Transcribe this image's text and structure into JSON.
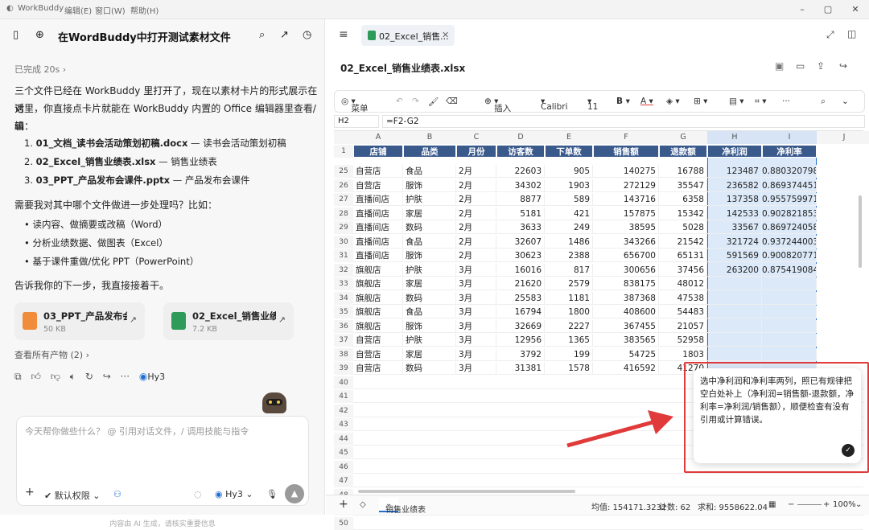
{
  "titlebar": {
    "app": "WorkBuddy",
    "menus": [
      "编辑(E)",
      "窗口(W)",
      "帮助(H)"
    ]
  },
  "chat": {
    "title": "在WordBuddy中打开测试素材文件",
    "done": "已完成 20s",
    "intro1": "三个文件已经在 WorkBuddy 里打开了，现在以素材卡片的形式展示在对",
    "intro2": "话里，你直接点卡片就能在 WorkBuddy 内置的 Office 编辑器里查看/编",
    "intro3": "辑：",
    "files": [
      {
        "num": "1.",
        "name": "01_文档_读书会活动策划初稿.docx",
        "desc": " — 读书会活动策划初稿"
      },
      {
        "num": "2.",
        "name": "02_Excel_销售业绩表.xlsx",
        "desc": " — 销售业绩表"
      },
      {
        "num": "3.",
        "name": "03_PPT_产品发布会课件.pptx",
        "desc": " — 产品发布会课件"
      }
    ],
    "question": "需要我对其中哪个文件做进一步处理吗？比如：",
    "bullets": [
      "读内容、做摘要或改稿（Word）",
      "分析业绩数据、做图表（Excel）",
      "基于课件重做/优化 PPT（PowerPoint）"
    ],
    "closing": "告诉我你的下一步，我直接接着干。",
    "cards": [
      {
        "name": "03_PPT_产品发布会...",
        "size": "50 KB",
        "color": "#f08c3a"
      },
      {
        "name": "02_Excel_销售业绩...",
        "size": "7.2 KB",
        "color": "#2e9b5a"
      }
    ],
    "view_all": "查看所有产物 (2)",
    "model": "Hy3"
  },
  "input": {
    "placeholder": "今天帮你做些什么？ @ 引用对话文件，/ 调用技能与指令",
    "permission": "默认权限",
    "model": "Hy3"
  },
  "footer": "内容由 AI 生成，请核实重要信息",
  "editor": {
    "tab_label": "02_Excel_销售...",
    "file_name": "02_Excel_销售业绩表.xlsx",
    "toolbar": {
      "menu": "菜单",
      "insert": "插入",
      "font": "Calibri",
      "size": "11"
    },
    "cell_ref": "H2",
    "formula": "=F2-G2",
    "columns": [
      "A",
      "B",
      "C",
      "D",
      "E",
      "F",
      "G",
      "H",
      "I",
      "J"
    ],
    "headers": [
      "店铺",
      "品类",
      "月份",
      "访客数",
      "下单数",
      "销售额",
      "退款额",
      "净利润",
      "净利率"
    ],
    "rows": [
      [
        "25",
        "自营店",
        "食品",
        "2月",
        "22603",
        "905",
        "140275",
        "16788",
        "123487",
        "0.880320798"
      ],
      [
        "26",
        "自营店",
        "服饰",
        "2月",
        "34302",
        "1903",
        "272129",
        "35547",
        "236582",
        "0.869374451"
      ],
      [
        "27",
        "直播间店",
        "护肤",
        "2月",
        "8877",
        "589",
        "143716",
        "6358",
        "137358",
        "0.955759971"
      ],
      [
        "28",
        "直播间店",
        "家居",
        "2月",
        "5181",
        "421",
        "157875",
        "15342",
        "142533",
        "0.902821853"
      ],
      [
        "29",
        "直播间店",
        "数码",
        "2月",
        "3633",
        "249",
        "38595",
        "5028",
        "33567",
        "0.869724058"
      ],
      [
        "30",
        "直播间店",
        "食品",
        "2月",
        "32607",
        "1486",
        "343266",
        "21542",
        "321724",
        "0.937244003"
      ],
      [
        "31",
        "直播间店",
        "服饰",
        "2月",
        "30623",
        "2388",
        "656700",
        "65131",
        "591569",
        "0.900820771"
      ],
      [
        "32",
        "旗舰店",
        "护肤",
        "3月",
        "16016",
        "817",
        "300656",
        "37456",
        "263200",
        "0.875419084"
      ],
      [
        "33",
        "旗舰店",
        "家居",
        "3月",
        "21620",
        "2579",
        "838175",
        "48012",
        "",
        ""
      ],
      [
        "34",
        "旗舰店",
        "数码",
        "3月",
        "25583",
        "1181",
        "387368",
        "47538",
        "",
        ""
      ],
      [
        "35",
        "旗舰店",
        "食品",
        "3月",
        "16794",
        "1800",
        "408600",
        "54483",
        "",
        ""
      ],
      [
        "36",
        "旗舰店",
        "服饰",
        "3月",
        "32669",
        "2227",
        "367455",
        "21057",
        "",
        ""
      ],
      [
        "37",
        "自营店",
        "护肤",
        "3月",
        "12956",
        "1365",
        "383565",
        "52958",
        "",
        ""
      ],
      [
        "38",
        "自营店",
        "家居",
        "3月",
        "3792",
        "199",
        "54725",
        "1803",
        "",
        ""
      ],
      [
        "39",
        "自营店",
        "数码",
        "3月",
        "31381",
        "1578",
        "416592",
        "41270",
        "",
        ""
      ]
    ],
    "empty_rows": [
      "40",
      "41",
      "42",
      "43",
      "44",
      "45",
      "46",
      "47",
      "48",
      "49",
      "50"
    ],
    "sheet": "销售业绩表",
    "status": {
      "avg": "均值: 154171.3232",
      "count": "计数: 62",
      "sum": "求和: 9558622.04",
      "zoom": "100%"
    },
    "popup": "选中净利润和净利率两列，照已有规律把空白处补上（净利润=销售额-退款额，净利率=净利润/销售额），顺便检查有没有引用或计算错误。"
  },
  "colors": {
    "accent": "#1f6fd1",
    "header_fill": "#3a5a8c",
    "selection": "#dce9f8",
    "annotation": "#e03a3a"
  }
}
